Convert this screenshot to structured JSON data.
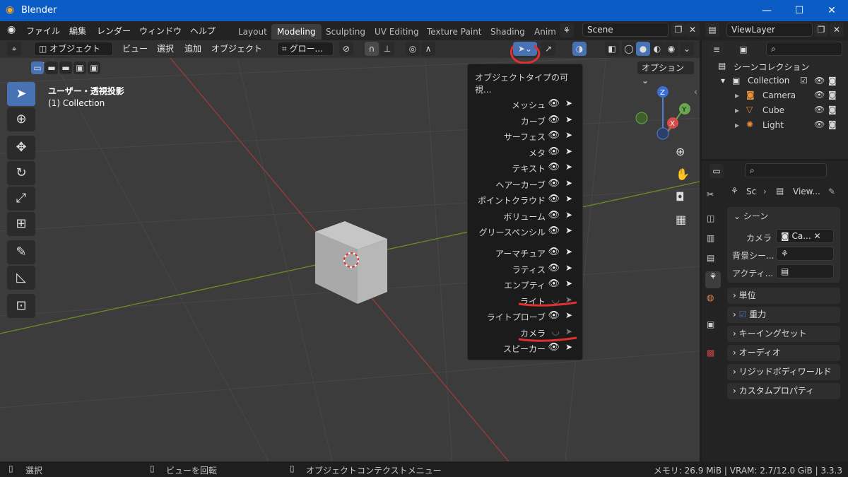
{
  "titlebar": {
    "title": "Blender",
    "min": "—",
    "max": "☐",
    "close": "✕"
  },
  "menu": [
    "ファイル",
    "編集",
    "レンダー",
    "ウィンドウ",
    "ヘルプ"
  ],
  "workspaces": [
    "Layout",
    "Modeling",
    "Sculpting",
    "UV Editing",
    "Texture Paint",
    "Shading",
    "Anim"
  ],
  "scene": {
    "label": "Scene"
  },
  "viewlayer": {
    "label": "ViewLayer"
  },
  "viewport_header": {
    "mode": "オブジェクト",
    "view": "ビュー",
    "select": "選択",
    "add": "追加",
    "object": "オブジェクト",
    "transform": "グロー...",
    "options": "オプション"
  },
  "viewport_info": {
    "line1": "ユーザー・透視投影",
    "line2": "(1) Collection"
  },
  "popup": {
    "title": "オブジェクトタイプの可視...",
    "rows": [
      {
        "label": "メッシュ",
        "on": true
      },
      {
        "label": "カーブ",
        "on": true
      },
      {
        "label": "サーフェス",
        "on": true
      },
      {
        "label": "メタ",
        "on": true
      },
      {
        "label": "テキスト",
        "on": true
      },
      {
        "label": "ヘアーカーブ",
        "on": true
      },
      {
        "label": "ポイントクラウド",
        "on": true
      },
      {
        "label": "ボリューム",
        "on": true
      },
      {
        "label": "グリースペンシル",
        "on": true
      },
      {
        "label": "アーマチュア",
        "on": true
      },
      {
        "label": "ラティス",
        "on": true
      },
      {
        "label": "エンプティ",
        "on": true
      },
      {
        "label": "ライト",
        "on": false
      },
      {
        "label": "ライトプローブ",
        "on": true
      },
      {
        "label": "カメラ",
        "on": false
      },
      {
        "label": "スピーカー",
        "on": true
      }
    ]
  },
  "outliner": {
    "scene_collection": "シーンコレクション",
    "collection": "Collection",
    "items": [
      "Camera",
      "Cube",
      "Light"
    ]
  },
  "properties": {
    "breadcrumb_scene": "Sc",
    "breadcrumb_view": "View...",
    "scene_panel": "シーン",
    "camera_label": "カメラ",
    "camera_value": "Ca...",
    "bg_label": "背景シー...",
    "active_label": "アクティ...",
    "panels": [
      "単位",
      "重力",
      "キーイングセット",
      "オーディオ",
      "リジッドボディワールド",
      "カスタムプロパティ"
    ]
  },
  "status": {
    "select": "選択",
    "rotate": "ビューを回転",
    "context": "オブジェクトコンテクストメニュー",
    "info": "メモリ: 26.9 MiB | VRAM: 2.7/12.0 GiB | 3.3.3"
  }
}
